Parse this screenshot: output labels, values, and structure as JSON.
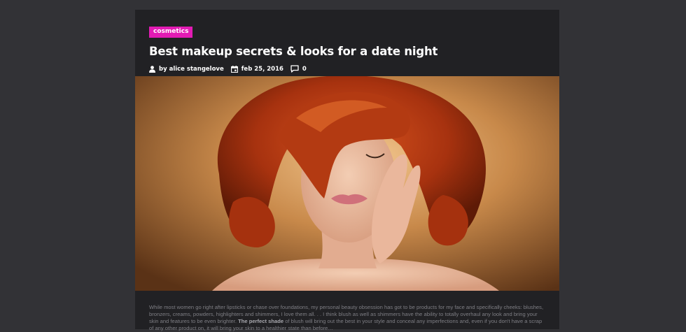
{
  "post": {
    "category": "cosmetics",
    "title": "Best makeup secrets & looks for a date night",
    "meta": {
      "author": "by alice stangelove",
      "date": "feb 25, 2016",
      "comments": "0"
    },
    "hero_image": {
      "alt": "red-haired woman with curly bob"
    },
    "excerpt": {
      "before": "While most women go right after lipsticks or chase over foundations, my personal beauty obsession has got to be products for my face and specifically cheeks: blushes, bronzers, creams, powders, highlighters and shimmers, I love them all. . . I think blush as well as shimmers have the ability to totally overhaul any look and bring your skin and features to be even brighter. ",
      "bold": "The perfect shade",
      "after": " of blush will bring out the best in your style and conceal any imperfections and, even if you don't have a scrap of any other product on, it will bring your skin to a healthier state than before…"
    }
  },
  "colors": {
    "background": "#323236",
    "card": "#212124",
    "badge": "#e21bb4"
  },
  "icons": [
    "user-icon",
    "calendar-icon",
    "comment-icon"
  ]
}
